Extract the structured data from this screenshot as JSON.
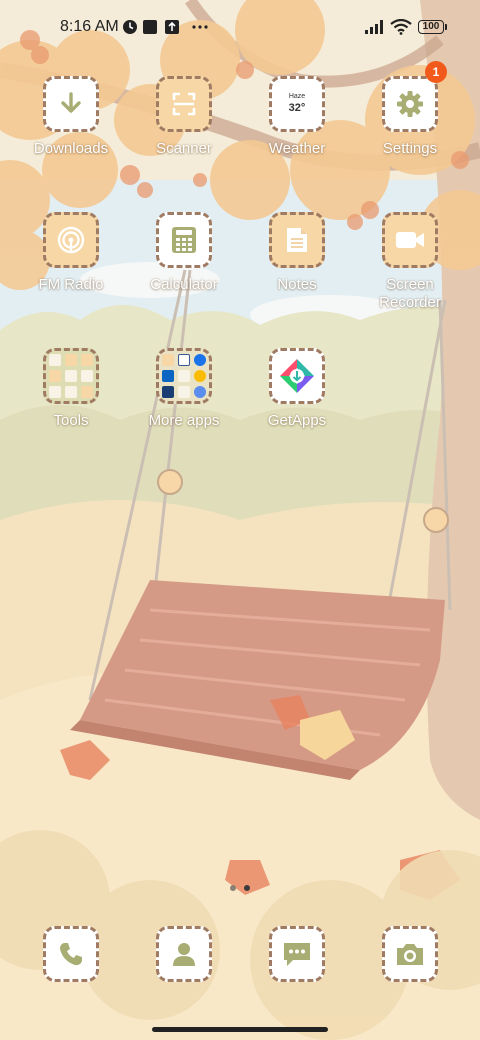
{
  "status_bar": {
    "time": "8:16 AM",
    "battery": "100",
    "icons": [
      "clock-icon",
      "square-notification-icon",
      "upload-icon",
      "more-icon",
      "signal-icon",
      "wifi-icon",
      "battery-icon"
    ]
  },
  "apps_row1": [
    {
      "label": "Downloads",
      "icon": "download-arrow-icon"
    },
    {
      "label": "Scanner",
      "icon": "scanner-icon"
    },
    {
      "label": "Weather",
      "icon": "weather-icon",
      "condition": "Haze",
      "temp": "32°"
    },
    {
      "label": "Settings",
      "icon": "gear-icon",
      "badge": "1"
    }
  ],
  "apps_row2": [
    {
      "label": "FM Radio",
      "icon": "radio-icon"
    },
    {
      "label": "Calculator",
      "icon": "calculator-icon"
    },
    {
      "label": "Notes",
      "icon": "notes-icon"
    },
    {
      "label": "Screen\nRecorder",
      "icon": "video-camera-icon"
    }
  ],
  "apps_row3": [
    {
      "label": "Tools",
      "icon": "folder-icon"
    },
    {
      "label": "More apps",
      "icon": "folder-icon"
    },
    {
      "label": "GetApps",
      "icon": "getapps-icon"
    }
  ],
  "dock": [
    {
      "icon": "phone-icon"
    },
    {
      "icon": "contacts-icon"
    },
    {
      "icon": "messages-icon"
    },
    {
      "icon": "camera-icon"
    }
  ],
  "page_dots": 2,
  "colors": {
    "icon_border": "#a07b63",
    "icon_glyph": "#a8ad74",
    "badge": "#f25a1c"
  }
}
